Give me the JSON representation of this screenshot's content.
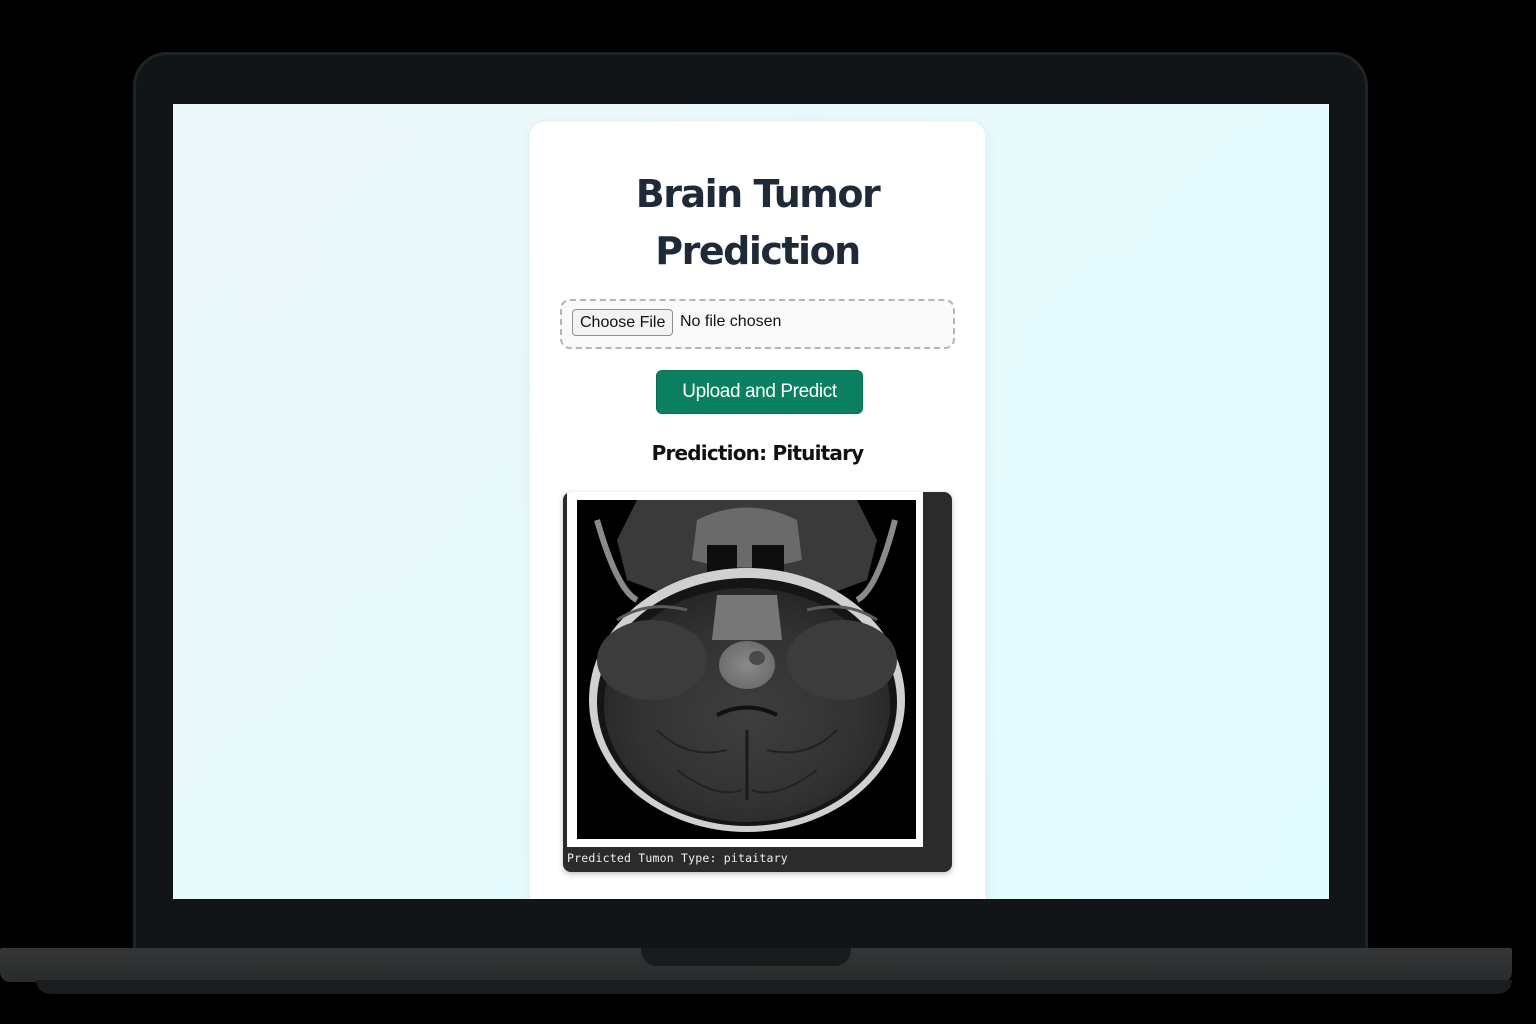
{
  "app": {
    "title": "Brain Tumor Prediction",
    "upload": {
      "choose_button_label": "Choose File",
      "file_status": "No file chosen"
    },
    "predict_button_label": "Upload and Predict",
    "prediction_text": "Prediction: Pituitary",
    "result_image": {
      "caption": "Predicted Tumon Type: pitaitary",
      "icon": "mri-scan-image"
    }
  },
  "colors": {
    "accent": "#0a8060",
    "title": "#1f2937",
    "page_background": "#e6fbfd"
  }
}
